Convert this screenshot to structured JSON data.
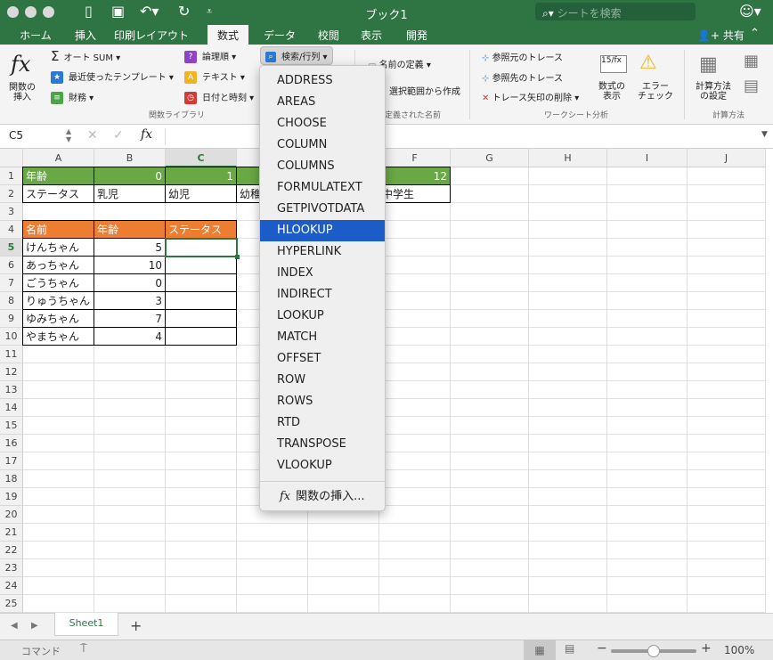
{
  "window": {
    "title": "ブック1",
    "search_placeholder": "シートを検索",
    "share": "共有"
  },
  "ribbon_tabs": [
    "ホーム",
    "挿入",
    "印刷レイアウト",
    "数式",
    "データ",
    "校閲",
    "表示",
    "開発"
  ],
  "active_tab": "数式",
  "ribbon": {
    "insert_function": "関数の\n挿入",
    "autosum": "オート SUM",
    "recent": "最近使ったテンプレート",
    "financial": "財務",
    "logical": "論理順",
    "text": "テキスト",
    "datetime": "日付と時刻",
    "lookup": "検索/行列",
    "library_group": "関数ライブラリ",
    "define_name": "名前の定義",
    "create_from_selection": "選択範囲から作成",
    "names_group": "定義された名前",
    "trace_precedents": "参照元のトレース",
    "trace_dependents": "参照先のトレース",
    "remove_arrows": "トレース矢印の削除",
    "show_formulas": "数式の\n表示",
    "error_check": "エラー\nチェック",
    "audit_group": "ワークシート分析",
    "calc_options": "計算方法\nの設定",
    "calc_group": "計算方法"
  },
  "formula_bar": {
    "name_box": "C5",
    "value": ""
  },
  "columns": [
    "A",
    "B",
    "C",
    "D",
    "E",
    "F",
    "G",
    "H",
    "I",
    "J"
  ],
  "selected_column": "C",
  "selected_row": 5,
  "cells": {
    "A1": "年齢",
    "B1": "0",
    "C1": "1",
    "F1": "12",
    "A2": "ステータス",
    "B2": "乳児",
    "C2": "幼児",
    "D2": "幼稚",
    "F2": "中学生",
    "A4": "名前",
    "B4": "年齢",
    "C4": "ステータス",
    "A5": "けんちゃん",
    "B5": "5",
    "A6": "あっちゃん",
    "B6": "10",
    "A7": "ごうちゃん",
    "B7": "0",
    "A8": "りゅうちゃん",
    "B8": "3",
    "A9": "ゆみちゃん",
    "B9": "7",
    "A10": "やまちゃん",
    "B10": "4"
  },
  "dropdown": {
    "items": [
      "ADDRESS",
      "AREAS",
      "CHOOSE",
      "COLUMN",
      "COLUMNS",
      "FORMULATEXT",
      "GETPIVOTDATA",
      "HLOOKUP",
      "HYPERLINK",
      "INDEX",
      "INDIRECT",
      "LOOKUP",
      "MATCH",
      "OFFSET",
      "ROW",
      "ROWS",
      "RTD",
      "TRANSPOSE",
      "VLOOKUP"
    ],
    "highlighted": "HLOOKUP",
    "footer": "関数の挿入..."
  },
  "sheet_tabs": [
    "Sheet1"
  ],
  "status": {
    "mode": "コマンド",
    "zoom": "100%",
    "zoom_fraction": 0.5
  }
}
